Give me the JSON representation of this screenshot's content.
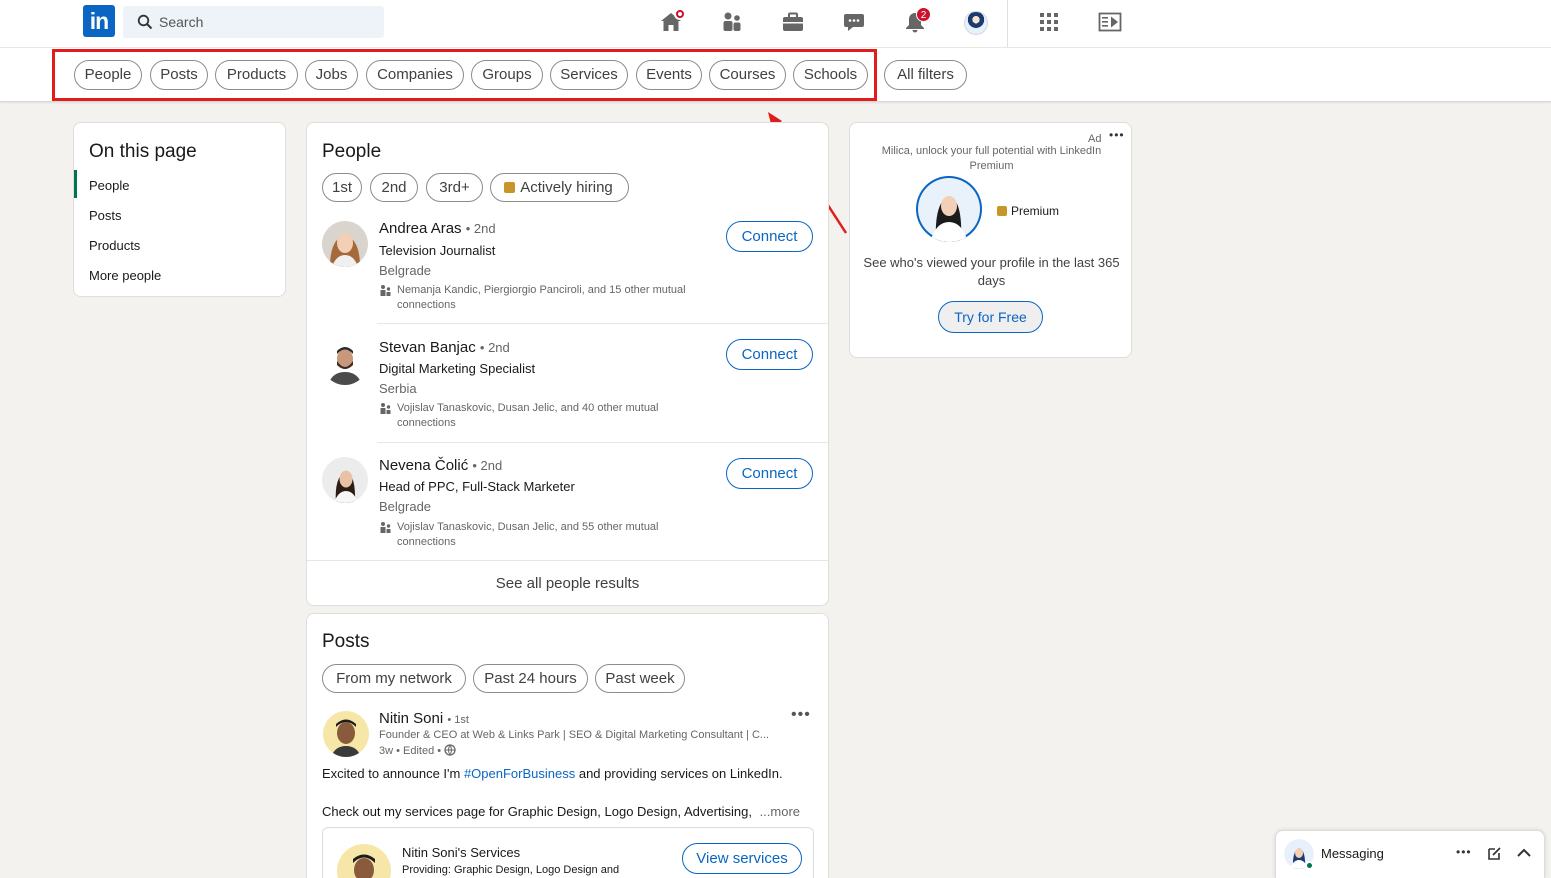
{
  "colors": {
    "brand": "#0a66c2",
    "badge": "#cb112d",
    "highlight": "#e21b1b",
    "active_nav": "#01754f"
  },
  "nav": {
    "logo_text": "in",
    "search_placeholder": "Search",
    "notifications_count": "2",
    "icons": [
      "home-icon",
      "my-network-icon",
      "jobs-icon",
      "messaging-icon",
      "notifications-icon",
      "me-avatar",
      "work-grid-icon",
      "advertise-icon"
    ]
  },
  "filters": [
    {
      "label": "People"
    },
    {
      "label": "Posts"
    },
    {
      "label": "Products"
    },
    {
      "label": "Jobs"
    },
    {
      "label": "Companies"
    },
    {
      "label": "Groups"
    },
    {
      "label": "Services"
    },
    {
      "label": "Events"
    },
    {
      "label": "Courses"
    },
    {
      "label": "Schools"
    },
    {
      "label": "All filters"
    }
  ],
  "on_this_page": {
    "title": "On this page",
    "links": [
      "People",
      "Posts",
      "Products",
      "More people"
    ]
  },
  "people": {
    "title": "People",
    "chips": [
      "1st",
      "2nd",
      "3rd+",
      "Actively hiring"
    ],
    "results": [
      {
        "name": "Andrea Aras",
        "degree": "• 2nd",
        "title": "Television Journalist",
        "location": "Belgrade",
        "mutual": "Nemanja Kandic, Piergiorgio Panciroli, and 15 other mutual connections",
        "action": "Connect"
      },
      {
        "name": "Stevan Banjac",
        "degree": "• 2nd",
        "title": "Digital Marketing Specialist",
        "location": "Serbia",
        "mutual": "Vojislav Tanaskovic, Dusan Jelic, and 40 other mutual connections",
        "action": "Connect"
      },
      {
        "name": "Nevena Čolić",
        "degree": "• 2nd",
        "title": "Head of PPC, Full-Stack Marketer",
        "location": "Belgrade",
        "mutual": "Vojislav Tanaskovic, Dusan Jelic, and 55 other mutual connections",
        "action": "Connect"
      }
    ],
    "see_all": "See all people results"
  },
  "posts": {
    "title": "Posts",
    "chips": [
      "From my network",
      "Past 24 hours",
      "Past week"
    ],
    "post": {
      "author": "Nitin Soni",
      "degree": "• 1st",
      "headline": "Founder & CEO at Web & Links Park | SEO & Digital Marketing Consultant | C...",
      "meta": "3w • Edited •",
      "text_before": "Excited to announce I'm ",
      "hashtag": "#OpenForBusiness",
      "text_after": " and providing services on LinkedIn.",
      "text2": "Check out my services page for Graphic Design, Logo Design, Advertising,",
      "more": "...more",
      "service_title": "Nitin Soni's Services",
      "service_desc": "Providing: Graphic Design, Logo Design and",
      "service_action": "View services"
    }
  },
  "ad": {
    "label": "Ad",
    "headline": "Milica, unlock your full potential with LinkedIn Premium",
    "premium": "Premium",
    "body": "See who's viewed your profile in the last 365 days",
    "cta": "Try for Free"
  },
  "messaging": {
    "label": "Messaging"
  }
}
